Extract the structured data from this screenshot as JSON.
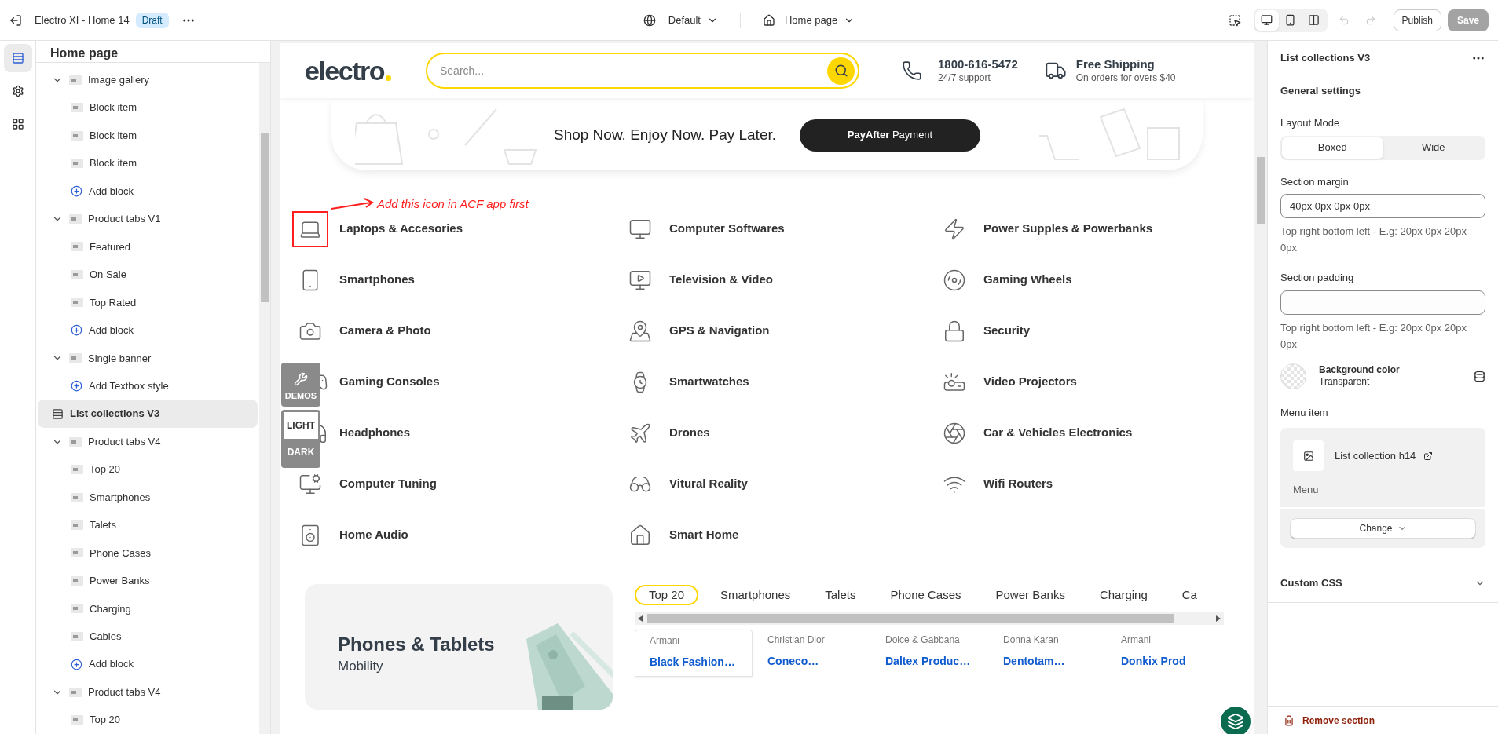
{
  "topbar": {
    "title": "Electro XI - Home 14",
    "badge": "Draft",
    "theme": "Default",
    "page": "Home page",
    "devices": [
      {
        "selected": true
      },
      {
        "selected": false
      },
      {
        "selected": false
      }
    ],
    "history": [
      {
        "disabled": true
      },
      {
        "disabled": true
      }
    ],
    "publish": "Publish",
    "save": {
      "label": "Save",
      "disabled": true
    }
  },
  "rail": [
    {
      "selected": true
    },
    {
      "selected": false
    },
    {
      "selected": false
    }
  ],
  "sidebar": {
    "title": "Home page",
    "items": [
      {
        "kind": "section",
        "label": "Image gallery",
        "selected": false,
        "expanded": true,
        "children": [
          {
            "kind": "block",
            "label": "Block item",
            "selected": false
          },
          {
            "kind": "block",
            "label": "Block item",
            "selected": false
          },
          {
            "kind": "block",
            "label": "Block item",
            "selected": false
          },
          {
            "kind": "add",
            "label": "Add block",
            "selected": false
          }
        ]
      },
      {
        "kind": "section",
        "label": "Product tabs V1",
        "selected": false,
        "expanded": true,
        "children": [
          {
            "kind": "block",
            "label": "Featured",
            "selected": false
          },
          {
            "kind": "block",
            "label": "On Sale",
            "selected": false
          },
          {
            "kind": "block",
            "label": "Top Rated",
            "selected": false
          },
          {
            "kind": "add",
            "label": "Add block",
            "selected": false
          }
        ]
      },
      {
        "kind": "section",
        "label": "Single banner",
        "selected": false,
        "expanded": true,
        "children": [
          {
            "kind": "add",
            "label": "Add Textbox style",
            "selected": false
          }
        ]
      },
      {
        "kind": "list",
        "label": "List collections V3",
        "selected": true
      },
      {
        "kind": "section",
        "label": "Product tabs V4",
        "selected": false,
        "expanded": true,
        "children": [
          {
            "kind": "block",
            "label": "Top 20",
            "selected": false
          },
          {
            "kind": "block",
            "label": "Smartphones",
            "selected": false
          },
          {
            "kind": "block",
            "label": "Talets",
            "selected": false
          },
          {
            "kind": "block",
            "label": "Phone Cases",
            "selected": false
          },
          {
            "kind": "block",
            "label": "Power Banks",
            "selected": false
          },
          {
            "kind": "block",
            "label": "Charging",
            "selected": false
          },
          {
            "kind": "block",
            "label": "Cables",
            "selected": false
          },
          {
            "kind": "add",
            "label": "Add block",
            "selected": false
          }
        ]
      },
      {
        "kind": "section",
        "label": "Product tabs V4",
        "selected": false,
        "expanded": true,
        "children": [
          {
            "kind": "block",
            "label": "Top 20",
            "selected": false
          }
        ]
      }
    ]
  },
  "preview": {
    "logo": "electro",
    "search": {
      "placeholder": "Search..."
    },
    "phone": {
      "number": "1800-616-5472",
      "note": "24/7 support"
    },
    "shipping": {
      "title": "Free Shipping",
      "note": "On orders for overs $40"
    },
    "banner": {
      "text": "Shop Now. Enjoy Now. Pay Later.",
      "button": "**PayAfter** Payment"
    },
    "annotation": "Add this icon in ACF app first",
    "category_columns": [
      {
        "items": [
          {
            "label": "Laptops & Accesories",
            "highlighted": true
          },
          {
            "label": "Smartphones",
            "highlighted": false
          },
          {
            "label": "Camera & Photo",
            "highlighted": false
          },
          {
            "label": "Gaming Consoles"
          },
          {
            "label": "Headphones"
          },
          {
            "label": "Computer Tuning",
            "highlighted": false
          },
          {
            "label": "Home Audio",
            "highlighted": false
          }
        ]
      },
      {
        "items": [
          {
            "label": "Computer Softwares",
            "highlighted": false
          },
          {
            "label": "Television & Video",
            "highlighted": false
          },
          {
            "label": "GPS & Navigation",
            "highlighted": false
          },
          {
            "label": "Smartwatches",
            "highlighted": false
          },
          {
            "label": "Drones",
            "highlighted": false
          },
          {
            "label": "Vitural Reality",
            "highlighted": false
          },
          {
            "label": "Smart Home",
            "highlighted": false
          }
        ]
      },
      {
        "items": [
          {
            "label": "Power Supples & Powerbanks",
            "highlighted": false
          },
          {
            "label": "Gaming Wheels",
            "highlighted": false
          },
          {
            "label": "Security",
            "highlighted": false
          },
          {
            "label": "Video Projectors",
            "highlighted": false
          },
          {
            "label": "Car & Vehicles Electronics",
            "highlighted": false
          },
          {
            "label": "Wifi Routers",
            "highlighted": false
          }
        ]
      }
    ],
    "demos": "DEMOS",
    "theme_modes": [
      {
        "label": "LIGHT",
        "selected": true
      },
      {
        "label": "DARK",
        "selected": false
      }
    ],
    "promo": {
      "title": "Phones & Tablets",
      "subtitle": "Mobility"
    },
    "product_tabs": [
      {
        "label": "Top 20",
        "selected": true
      },
      {
        "label": "Smartphones",
        "selected": false
      },
      {
        "label": "Talets",
        "selected": false
      },
      {
        "label": "Phone Cases",
        "selected": false
      },
      {
        "label": "Power Banks",
        "selected": false
      },
      {
        "label": "Charging",
        "selected": false
      },
      {
        "label": "Ca",
        "selected": false
      }
    ],
    "products": [
      {
        "brand": "Armani",
        "title": "Black Fashion…",
        "selected": true
      },
      {
        "brand": "Christian Dior",
        "title": "Coneco…",
        "selected": false
      },
      {
        "brand": "Dolce & Gabbana",
        "title": "Daltex Produc…",
        "selected": false
      },
      {
        "brand": "Donna Karan",
        "title": "Dentotam…",
        "selected": false
      },
      {
        "brand": "Armani",
        "title": "Donkix Prod",
        "selected": false
      }
    ]
  },
  "panel": {
    "title": "List collections V3",
    "group": "General settings",
    "layout_label": "Layout Mode",
    "layout_options": [
      {
        "label": "Boxed",
        "selected": true
      },
      {
        "label": "Wide",
        "selected": false
      }
    ],
    "margin": {
      "label": "Section margin",
      "value": "40px 0px 0px 0px",
      "hint": "Top right bottom left - E.g: 20px 0px 20px 0px"
    },
    "padding": {
      "label": "Section padding",
      "hint": "Top right bottom left - E.g: 20px 0px 20px 0px"
    },
    "background": {
      "label": "Background color",
      "value": "Transparent"
    },
    "menu": {
      "label": "Menu item",
      "name": "List collection h14",
      "type": "Menu",
      "button": "Change"
    },
    "custom_css": {
      "label": "Custom CSS",
      "expanded": false
    },
    "remove": "Remove section"
  }
}
